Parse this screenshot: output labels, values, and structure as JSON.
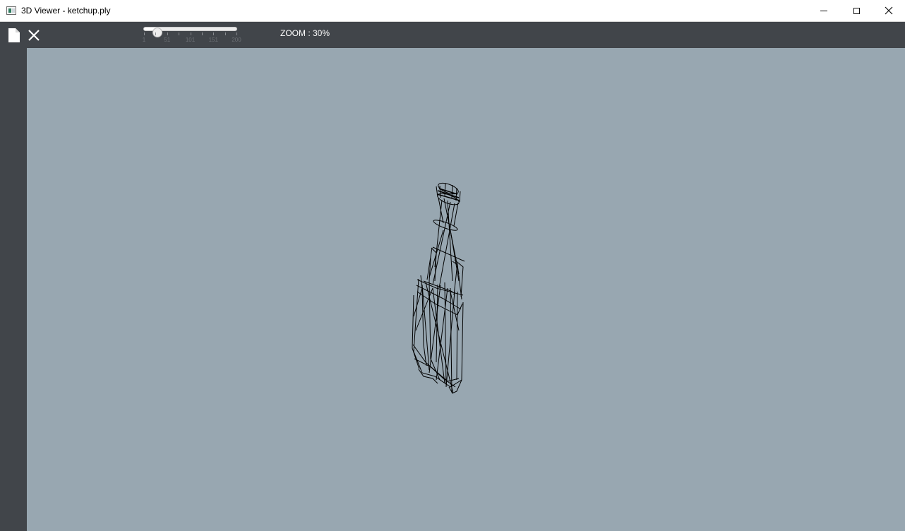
{
  "window": {
    "title": "3D Viewer - ketchup.ply",
    "app_icon": "app-window-icon",
    "controls": {
      "minimize": "minimize-icon",
      "maximize": "maximize-icon",
      "close": "close-icon"
    }
  },
  "toolbar": {
    "open_button": {
      "icon": "file-icon"
    },
    "close_button": {
      "icon": "close-x-icon"
    },
    "zoom_slider": {
      "value": 30,
      "min": 1,
      "max": 200,
      "tick_labels": [
        "1",
        "51",
        "101",
        "151",
        "200"
      ]
    },
    "zoom_label": "ZOOM : 30%"
  },
  "viewport": {
    "background": "#98a7b1",
    "model_name": "ketchup.ply",
    "render_mode": "wireframe",
    "wire_color": "#000000"
  },
  "colors": {
    "toolbar_bg": "#41454a",
    "titlebar_bg": "#ffffff"
  }
}
